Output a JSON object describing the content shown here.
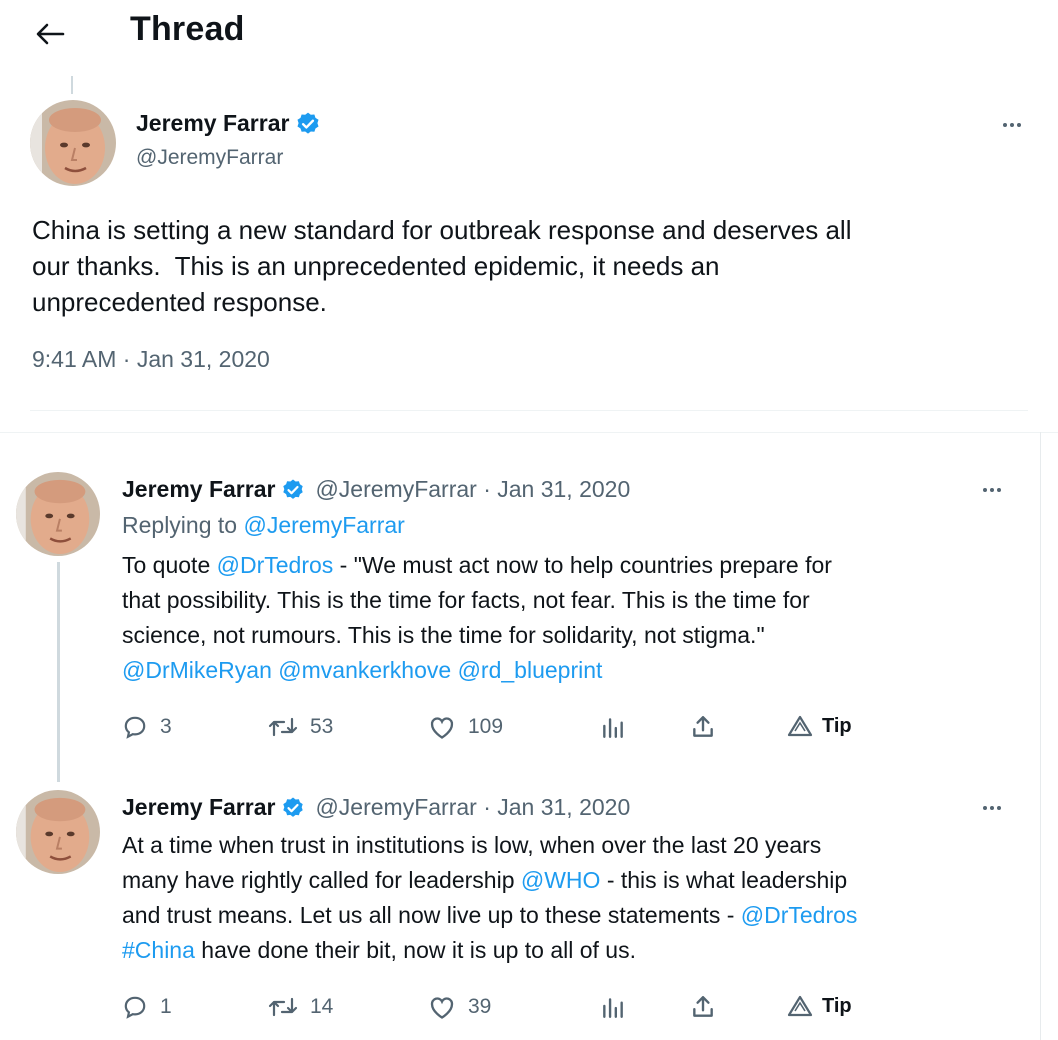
{
  "header": {
    "title": "Thread",
    "back_icon": "arrow-left-icon"
  },
  "colors": {
    "link": "#1d9bf0",
    "verified": "#1d9bf0",
    "muted": "#536471",
    "text": "#0f1419"
  },
  "main_tweet": {
    "name": "Jeremy Farrar",
    "handle": "@JeremyFarrar",
    "text_lines": [
      "China is setting a new standard for outbreak response and deserves all",
      "our thanks.  This is an unprecedented epidemic, it needs an",
      "unprecedented response."
    ],
    "timestamp": "9:41 AM · Jan 31, 2020"
  },
  "replies": [
    {
      "name": "Jeremy Farrar",
      "meta": "@JeremyFarrar · Jan 31, 2020",
      "replying_prefix": "Replying to ",
      "replying_to": "@JeremyFarrar",
      "text": {
        "l1_pre": "To quote ",
        "l1_link": "@DrTedros",
        "l1_post": " - \"We must act now to help countries prepare for",
        "l2": "that possibility. This is the time for facts, not fear. This is the time for",
        "l3": "science, not rumours. This is the time for solidarity, not stigma.\"",
        "l4_link1": "@DrMikeRyan",
        "l4_link2": "@mvankerkhove",
        "l4_link3": "@rd_blueprint"
      },
      "actions": {
        "replies": "3",
        "retweets": "53",
        "likes": "109",
        "tip": "Tip"
      }
    },
    {
      "name": "Jeremy Farrar",
      "meta": "@JeremyFarrar · Jan 31, 2020",
      "text": {
        "l1": "At a time when trust in institutions is low, when over the last 20 years",
        "l2_pre": "many have rightly called for leadership ",
        "l2_link": "@WHO",
        "l2_post": " - this is what leadership",
        "l3_pre": "and trust means. Let us all now live up to these statements - ",
        "l3_link": "@DrTedros",
        "l4_link": "#China",
        "l4_post": " have done their bit, now it is up to all of us."
      },
      "actions": {
        "replies": "1",
        "retweets": "14",
        "likes": "39",
        "tip": "Tip"
      }
    }
  ]
}
